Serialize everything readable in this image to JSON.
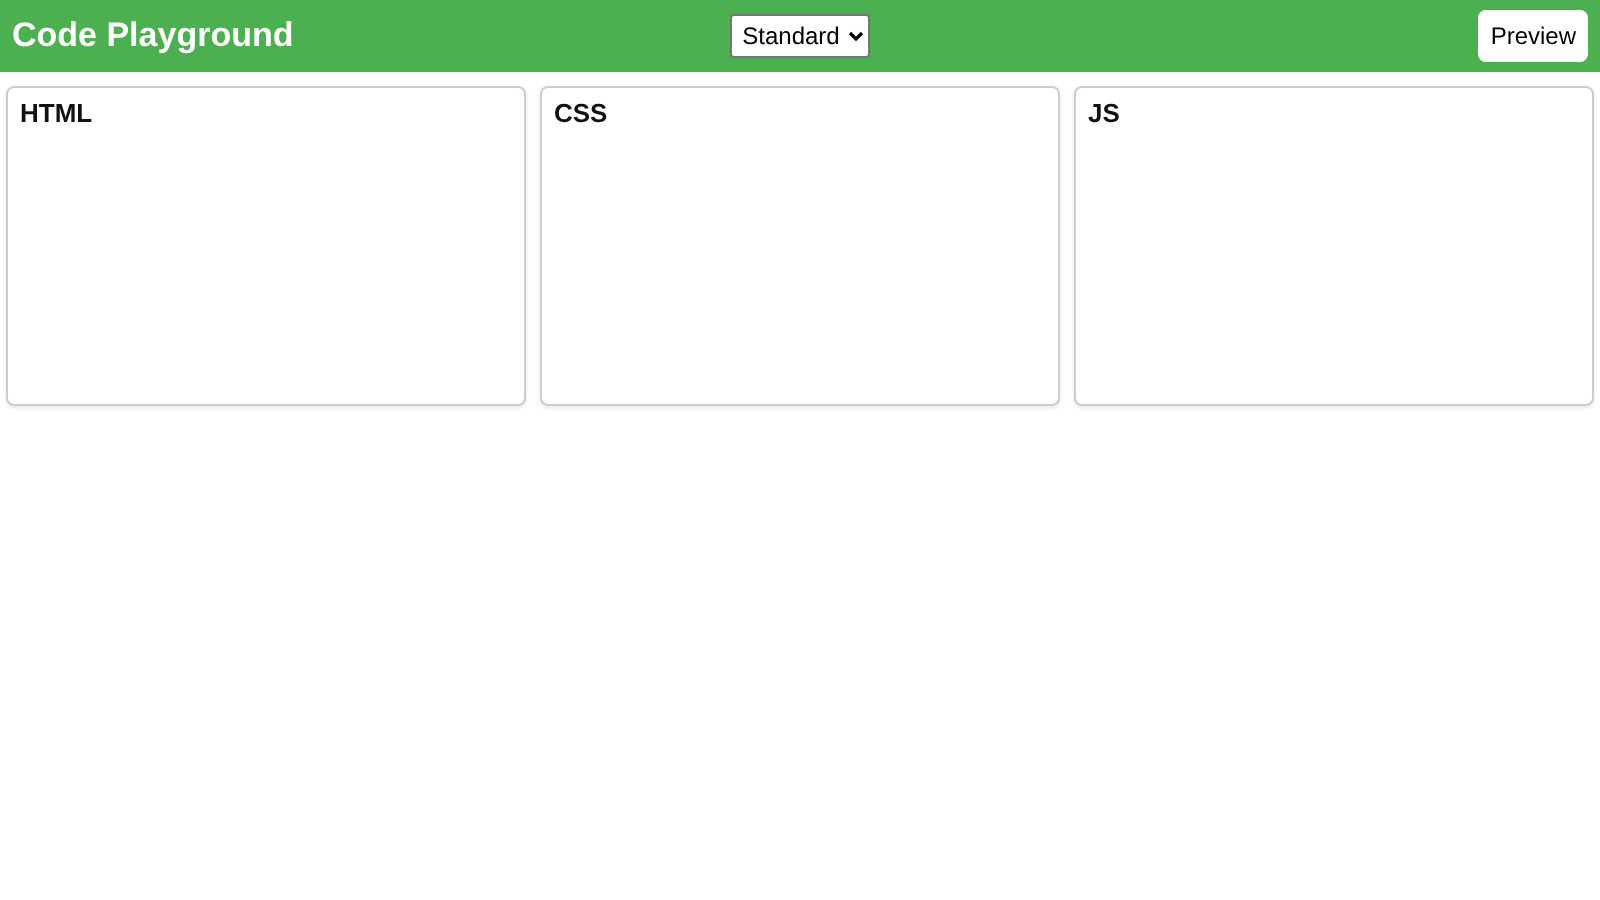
{
  "header": {
    "title": "Code Playground",
    "mode_select": {
      "value": "Standard"
    },
    "preview_button": "Preview"
  },
  "panels": [
    {
      "label": "HTML"
    },
    {
      "label": "CSS"
    },
    {
      "label": "JS"
    }
  ]
}
